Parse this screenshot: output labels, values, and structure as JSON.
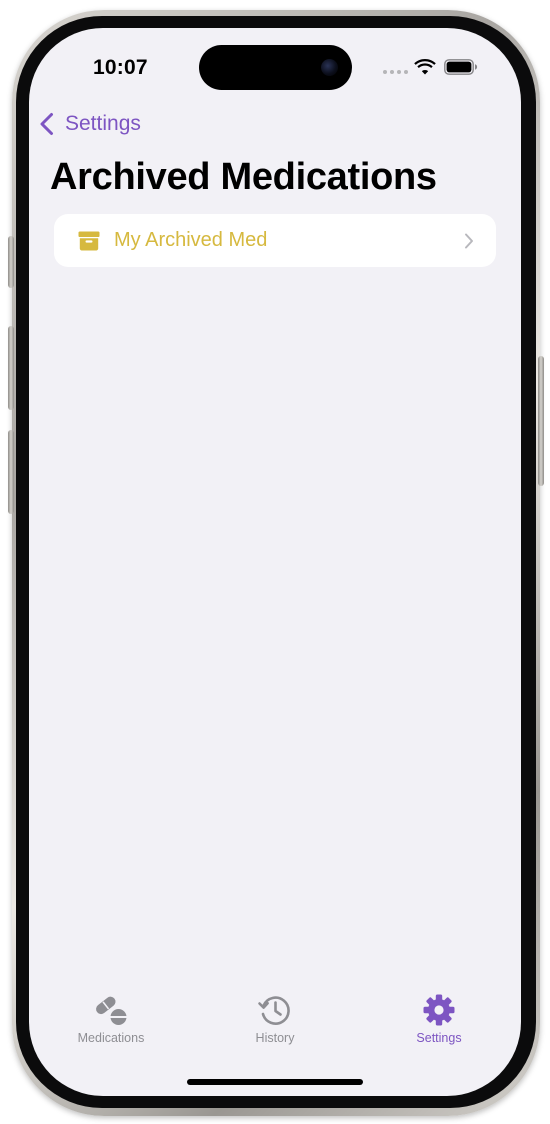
{
  "status_bar": {
    "time": "10:07"
  },
  "nav": {
    "back_label": "Settings",
    "title": "Archived Medications"
  },
  "archived_list": {
    "items": [
      {
        "label": "My Archived Med",
        "icon": "archivebox-icon"
      }
    ]
  },
  "tab_bar": {
    "tabs": [
      {
        "label": "Medications",
        "icon": "pills-icon",
        "active": false
      },
      {
        "label": "History",
        "icon": "history-clock-icon",
        "active": false
      },
      {
        "label": "Settings",
        "icon": "gear-icon",
        "active": true
      }
    ]
  },
  "colors": {
    "accent": "#7d55c2",
    "archived_item": "#d6b93f",
    "inactive_tab": "#8e8e93",
    "background": "#f2f1f6"
  }
}
